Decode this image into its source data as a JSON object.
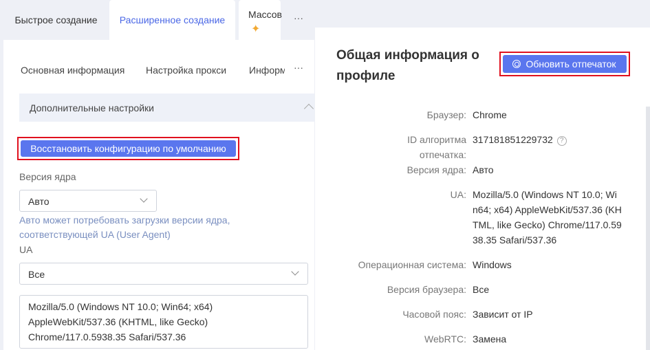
{
  "top_tabs": {
    "quick": "Быстрое создание",
    "advanced": "Расширенное создание",
    "bulk": "Массов",
    "more": "···"
  },
  "sub_tabs": {
    "basic": "Основная информация",
    "proxy": "Настройка прокси",
    "info": "Информ",
    "more": "···"
  },
  "section": {
    "label": "Дополнительные настройки"
  },
  "restore_button": "Восстановить конфигурацию по умолчанию",
  "kernel": {
    "label": "Версия ядра",
    "value": "Авто",
    "hint": "Авто может потребовать загрузки версии ядра, соответствующей UA (User Agent)"
  },
  "ua": {
    "label": "UA",
    "select_value": "Все",
    "text": "Mozilla/5.0 (Windows NT 10.0; Win64; x64) AppleWebKit/537.36 (KHTML, like Gecko) Chrome/117.0.5938.35 Safari/537.36"
  },
  "profile": {
    "title": "Общая информация о профиле",
    "refresh_button": "Обновить отпечаток",
    "rows": [
      {
        "key": "Браузер:",
        "value": "Chrome"
      },
      {
        "key": "ID алгоритма отпечатка:",
        "value": "317181851229732"
      },
      {
        "key": "Версия ядра:",
        "value": "Авто"
      },
      {
        "key": "UA:",
        "value": "Mozilla/5.0 (Windows NT 10.0; Wi n64; x64) AppleWebKit/537.36 (KH TML, like Gecko) Chrome/117.0.59 38.35 Safari/537.36"
      },
      {
        "key": "Операционная система:",
        "value": "Windows"
      },
      {
        "key": "Версия браузера:",
        "value": "Все"
      },
      {
        "key": "Часовой пояс:",
        "value": "Зависит от IP"
      },
      {
        "key": "WebRTC:",
        "value": "Замена"
      }
    ]
  },
  "colors": {
    "accent": "#5a76ee",
    "highlight": "#e0101e",
    "star": "#f2a933"
  }
}
